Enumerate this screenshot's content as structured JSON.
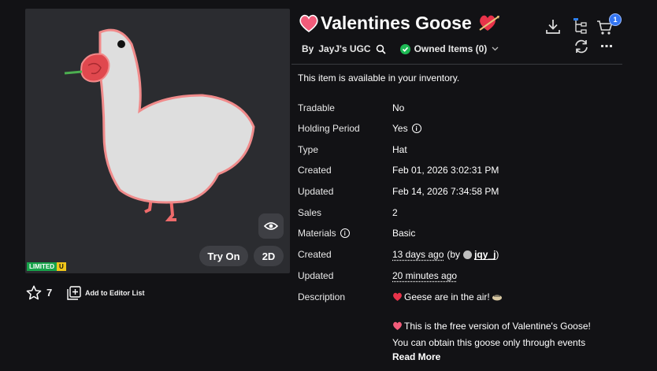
{
  "item": {
    "title": "Valentines Goose",
    "title_prefix_icon": "pink-heart-emoji",
    "title_suffix_icon": "heart-with-arrow-emoji",
    "creator_prefix": "By",
    "creator_name": "JayJ's UGC",
    "owned_label": "Owned Items (0)",
    "limited_label": "LIMITED",
    "limited_unique": "U"
  },
  "viewer": {
    "try_on_label": "Try On",
    "two_d_label": "2D"
  },
  "actions": {
    "favorites_count": "7",
    "add_to_editor_label": "Add to Editor List",
    "cart_count": "1"
  },
  "availability_text": "This item is available in your inventory.",
  "details": {
    "tradable_label": "Tradable",
    "tradable_value": "No",
    "holding_label": "Holding Period",
    "holding_value": "Yes",
    "type_label": "Type",
    "type_value": "Hat",
    "created_label": "Created",
    "created_value": "Feb 01, 2026 3:02:31 PM",
    "updated_label": "Updated",
    "updated_value": "Feb 14, 2026 7:34:58 PM",
    "sales_label": "Sales",
    "sales_value": "2",
    "materials_label": "Materials",
    "materials_value": "Basic",
    "created2_label": "Created",
    "created2_value": "13 days ago",
    "created2_by": "(by",
    "created2_user": "jqy_j",
    "created2_close": ")",
    "updated2_label": "Updated",
    "updated2_value": "20 minutes ago",
    "description_label": "Description"
  },
  "description": {
    "line1": "Geese are in the air!",
    "line2": "This is the free version of Valentine's Goose!",
    "line3": "You can obtain this goose only through events",
    "read_more": "Read More"
  },
  "colors": {
    "background": "#121215",
    "viewer_bg": "#2b2c30",
    "badge_blue": "#3375f2",
    "owned_green": "#1db954",
    "heart_pink": "#f25c7a"
  }
}
